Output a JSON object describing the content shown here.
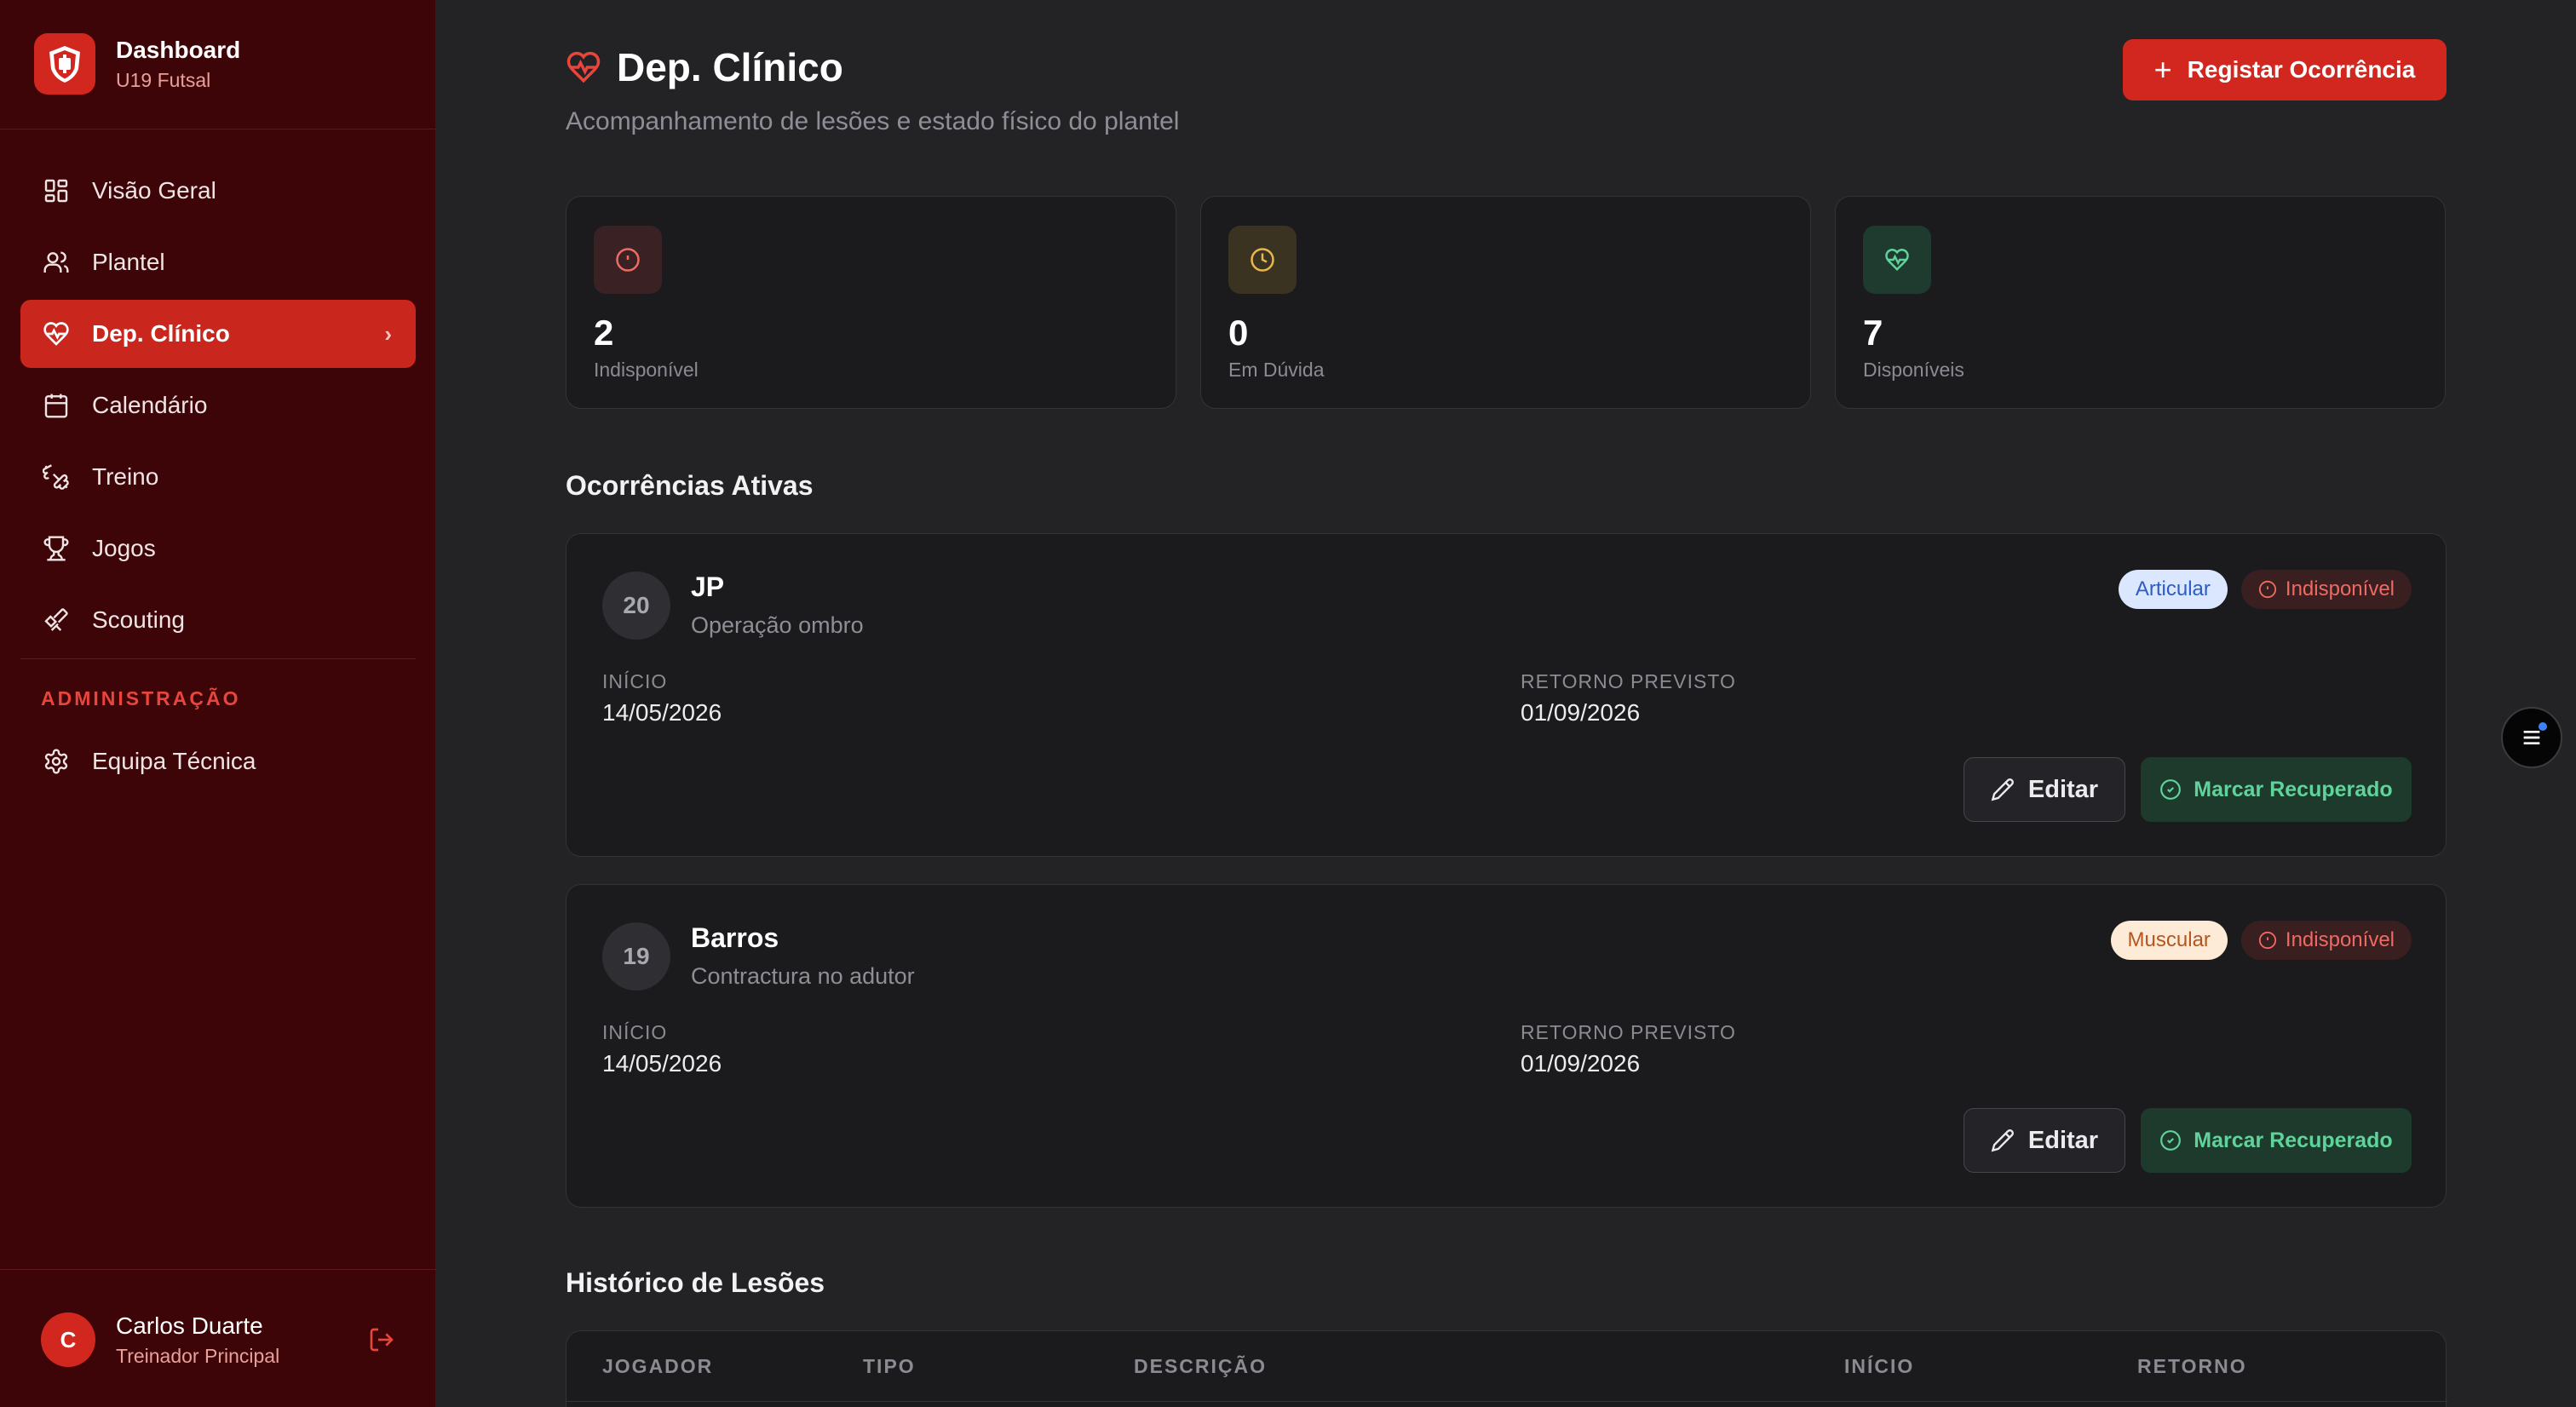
{
  "sidebar": {
    "brand": {
      "title": "Dashboard",
      "subtitle": "U19 Futsal"
    },
    "nav": [
      {
        "label": "Visão Geral",
        "icon": "grid-icon"
      },
      {
        "label": "Plantel",
        "icon": "users-icon"
      },
      {
        "label": "Dep. Clínico",
        "icon": "heart-pulse-icon",
        "active": true
      },
      {
        "label": "Calendário",
        "icon": "calendar-icon"
      },
      {
        "label": "Treino",
        "icon": "dumbbell-icon"
      },
      {
        "label": "Jogos",
        "icon": "trophy-icon"
      },
      {
        "label": "Scouting",
        "icon": "telescope-icon"
      }
    ],
    "admin_label": "ADMINISTRAÇÃO",
    "admin_nav": [
      {
        "label": "Equipa Técnica",
        "icon": "gear-icon"
      }
    ],
    "user": {
      "initial": "C",
      "name": "Carlos Duarte",
      "role": "Treinador Principal"
    }
  },
  "header": {
    "title": "Dep. Clínico",
    "subtitle": "Acompanhamento de lesões e estado físico do plantel",
    "primary_button": "Registar Ocorrência"
  },
  "stats": [
    {
      "value": "2",
      "label": "Indisponível",
      "icon": "alert-circle-icon"
    },
    {
      "value": "0",
      "label": "Em Dúvida",
      "icon": "clock-icon"
    },
    {
      "value": "7",
      "label": "Disponíveis",
      "icon": "heart-pulse-icon"
    }
  ],
  "active_section": {
    "title": "Ocorrências Ativas"
  },
  "occurrences": [
    {
      "number": "20",
      "name": "JP",
      "description": "Operação ombro",
      "type_tag": "Articular",
      "status_tag": "Indisponível",
      "start_label": "INÍCIO",
      "start": "14/05/2026",
      "return_label": "RETORNO PREVISTO",
      "return": "01/09/2026",
      "edit_label": "Editar",
      "recover_label": "Marcar Recuperado"
    },
    {
      "number": "19",
      "name": "Barros",
      "description": "Contractura no adutor",
      "type_tag": "Muscular",
      "status_tag": "Indisponível",
      "start_label": "INÍCIO",
      "start": "14/05/2026",
      "return_label": "RETORNO PREVISTO",
      "return": "01/09/2026",
      "edit_label": "Editar",
      "recover_label": "Marcar Recuperado"
    }
  ],
  "history": {
    "title": "Histórico de Lesões",
    "columns": [
      "JOGADOR",
      "TIPO",
      "DESCRIÇÃO",
      "INÍCIO",
      "RETORNO"
    ]
  },
  "colors": {
    "accent": "#d1271f",
    "sidebar_bg": "#3d0507",
    "page_bg": "#232326",
    "card_bg": "#1b1b1e",
    "success": "#5fd39a",
    "warning": "#e8b64a"
  }
}
